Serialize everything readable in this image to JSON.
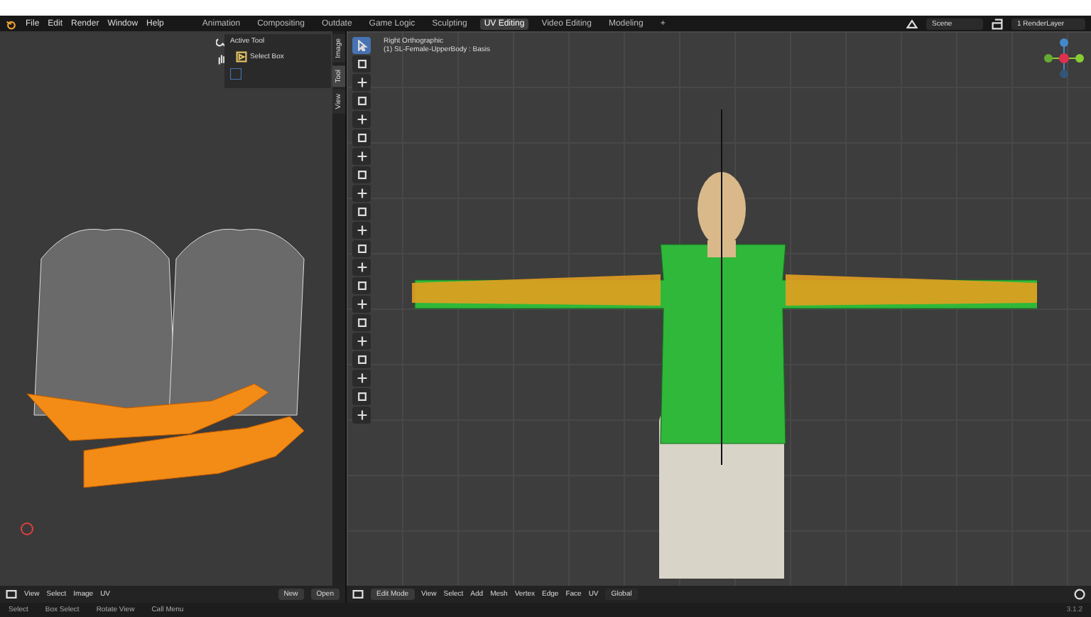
{
  "menu": [
    "File",
    "Edit",
    "Render",
    "Window",
    "Help"
  ],
  "workspaces": [
    {
      "label": "Animation",
      "selected": false
    },
    {
      "label": "Compositing",
      "selected": false
    },
    {
      "label": "Outdate",
      "selected": false
    },
    {
      "label": "Game Logic",
      "selected": false
    },
    {
      "label": "Sculpting",
      "selected": false
    },
    {
      "label": "UV Editing",
      "selected": true
    },
    {
      "label": "Video Editing",
      "selected": false
    },
    {
      "label": "Modeling",
      "selected": false
    }
  ],
  "add_workspace": "+",
  "scene": "Scene",
  "view_layer": "1 RenderLayer",
  "uv_editor": {
    "active_tool": {
      "title": "Active Tool",
      "tool": "Select Box"
    },
    "sidebar_tabs": [
      {
        "label": "Image",
        "selected": false
      },
      {
        "label": "Tool",
        "selected": true
      },
      {
        "label": "View",
        "selected": false
      }
    ],
    "menus": [
      "View",
      "Select",
      "Image",
      "UV"
    ],
    "new": "New",
    "open": "Open"
  },
  "viewport": {
    "view_name": "Right Orthographic",
    "object": "(1) SL-Female-UpperBody : Basis",
    "mode": "Edit Mode",
    "tools": [
      {
        "selected": true
      },
      {
        "selected": false
      },
      {
        "selected": false
      },
      {
        "selected": false
      },
      {
        "selected": false
      },
      {
        "selected": false
      },
      {
        "selected": false
      },
      {
        "selected": false
      },
      {
        "selected": false
      },
      {
        "selected": false
      },
      {
        "selected": false
      },
      {
        "selected": false
      },
      {
        "selected": false
      },
      {
        "selected": false
      },
      {
        "selected": false
      },
      {
        "selected": false
      },
      {
        "selected": false
      },
      {
        "selected": false
      },
      {
        "selected": false
      },
      {
        "selected": false
      },
      {
        "selected": false
      }
    ],
    "menus": [
      "View",
      "Select",
      "Add",
      "Mesh",
      "Vertex",
      "Edge",
      "Face",
      "UV"
    ],
    "orientation": "Global"
  },
  "status_bar": {
    "items": [
      "Select",
      "Box Select",
      "Rotate View",
      "Call Menu"
    ],
    "version": "3.1.2"
  }
}
